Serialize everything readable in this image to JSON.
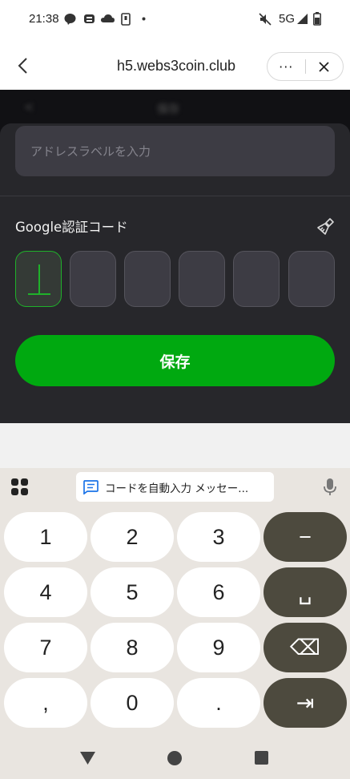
{
  "status_bar": {
    "time": "21:38",
    "network": "5G",
    "left_icons": [
      "line-app-icon",
      "notification-app-icon",
      "cloud-icon",
      "sim-card-icon",
      "dot-icon"
    ],
    "right_icons": [
      "mute-icon",
      "signal-icon",
      "battery-icon"
    ]
  },
  "browser": {
    "url": "h5.webs3coin.club",
    "more_label": "···"
  },
  "background_page": {
    "blurred_left": "≺",
    "blurred_title": "保存"
  },
  "form": {
    "address_label_placeholder": "アドレスラベルを入力",
    "google_auth_label": "Google認証コード",
    "code_boxes": [
      "",
      "",
      "",
      "",
      "",
      ""
    ],
    "save_label": "保存"
  },
  "keyboard": {
    "suggestion": "コードを自動入力  メッセー...",
    "keys": [
      [
        "1",
        "2",
        "3",
        "−"
      ],
      [
        "4",
        "5",
        "6",
        "␣"
      ],
      [
        "7",
        "8",
        "9",
        "⌫"
      ],
      [
        ",",
        "0",
        ".",
        "⇥"
      ]
    ],
    "accent_color": "#4d4a3e"
  },
  "colors": {
    "primary_green": "#00a910",
    "sheet_bg": "#27272b",
    "input_bg": "#3d3c44"
  }
}
